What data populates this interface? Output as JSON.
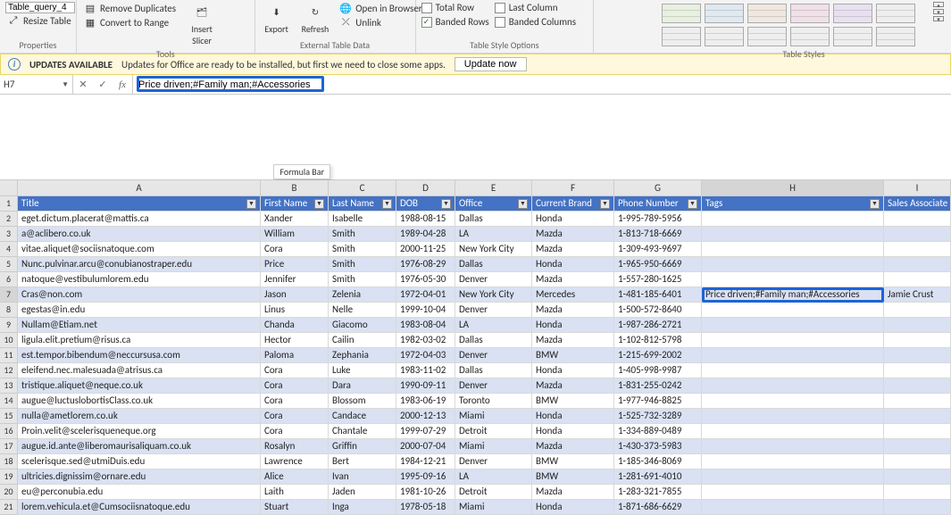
{
  "ribbon": {
    "properties": {
      "table_name": "Table_query_4",
      "resize": "Resize Table",
      "group": "Properties"
    },
    "tools": {
      "remove_dup": "Remove Duplicates",
      "convert": "Convert to Range",
      "slicer": "Insert Slicer",
      "group": "Tools"
    },
    "external": {
      "export": "Export",
      "refresh": "Refresh",
      "open_browser": "Open in Browser",
      "unlink": "Unlink",
      "group": "External Table Data"
    },
    "options": {
      "total_row": "Total Row",
      "banded_rows": "Banded Rows",
      "last_col": "Last Column",
      "banded_cols": "Banded Columns",
      "group": "Table Style Options"
    },
    "styles": {
      "group": "Table Styles"
    }
  },
  "update_bar": {
    "title": "UPDATES AVAILABLE",
    "msg": "Updates for Office are ready to be installed, but first we need to close some apps.",
    "btn": "Update now"
  },
  "formula_bar": {
    "cell_ref": "H7",
    "value": "Price driven;#Family man;#Accessories",
    "tooltip": "Formula Bar"
  },
  "columns": [
    "A",
    "B",
    "C",
    "D",
    "E",
    "F",
    "G",
    "H",
    "I"
  ],
  "headers": {
    "title": "Title",
    "first": "First Name",
    "last": "Last Name",
    "dob": "DOB",
    "office": "Office",
    "brand": "Current Brand",
    "phone": "Phone Number",
    "tags": "Tags",
    "assoc": "Sales Associate"
  },
  "rows": [
    {
      "n": 2,
      "title": "eget.dictum.placerat@mattis.ca",
      "first": "Xander",
      "last": "Isabelle",
      "dob": "1988-08-15",
      "office": "Dallas",
      "brand": "Honda",
      "phone": "1-995-789-5956",
      "tags": "",
      "assoc": ""
    },
    {
      "n": 3,
      "title": "a@aclibero.co.uk",
      "first": "William",
      "last": "Smith",
      "dob": "1989-04-28",
      "office": "LA",
      "brand": "Mazda",
      "phone": "1-813-718-6669",
      "tags": "",
      "assoc": ""
    },
    {
      "n": 4,
      "title": "vitae.aliquet@sociisnatoque.com",
      "first": "Cora",
      "last": "Smith",
      "dob": "2000-11-25",
      "office": "New York City",
      "brand": "Mazda",
      "phone": "1-309-493-9697",
      "tags": "",
      "assoc": ""
    },
    {
      "n": 5,
      "title": "Nunc.pulvinar.arcu@conubianostraper.edu",
      "first": "Price",
      "last": "Smith",
      "dob": "1976-08-29",
      "office": "Dallas",
      "brand": "Honda",
      "phone": "1-965-950-6669",
      "tags": "",
      "assoc": ""
    },
    {
      "n": 6,
      "title": "natoque@vestibulumlorem.edu",
      "first": "Jennifer",
      "last": "Smith",
      "dob": "1976-05-30",
      "office": "Denver",
      "brand": "Mazda",
      "phone": "1-557-280-1625",
      "tags": "",
      "assoc": ""
    },
    {
      "n": 7,
      "title": "Cras@non.com",
      "first": "Jason",
      "last": "Zelenia",
      "dob": "1972-04-01",
      "office": "New York City",
      "brand": "Mercedes",
      "phone": "1-481-185-6401",
      "tags": "Price driven;#Family man;#Accessories",
      "assoc": "Jamie Crust"
    },
    {
      "n": 8,
      "title": "egestas@in.edu",
      "first": "Linus",
      "last": "Nelle",
      "dob": "1999-10-04",
      "office": "Denver",
      "brand": "Mazda",
      "phone": "1-500-572-8640",
      "tags": "",
      "assoc": ""
    },
    {
      "n": 9,
      "title": "Nullam@Etiam.net",
      "first": "Chanda",
      "last": "Giacomo",
      "dob": "1983-08-04",
      "office": "LA",
      "brand": "Honda",
      "phone": "1-987-286-2721",
      "tags": "",
      "assoc": ""
    },
    {
      "n": 10,
      "title": "ligula.elit.pretium@risus.ca",
      "first": "Hector",
      "last": "Cailin",
      "dob": "1982-03-02",
      "office": "Dallas",
      "brand": "Mazda",
      "phone": "1-102-812-5798",
      "tags": "",
      "assoc": ""
    },
    {
      "n": 11,
      "title": "est.tempor.bibendum@neccursusa.com",
      "first": "Paloma",
      "last": "Zephania",
      "dob": "1972-04-03",
      "office": "Denver",
      "brand": "BMW",
      "phone": "1-215-699-2002",
      "tags": "",
      "assoc": ""
    },
    {
      "n": 12,
      "title": "eleifend.nec.malesuada@atrisus.ca",
      "first": "Cora",
      "last": "Luke",
      "dob": "1983-11-02",
      "office": "Dallas",
      "brand": "Honda",
      "phone": "1-405-998-9987",
      "tags": "",
      "assoc": ""
    },
    {
      "n": 13,
      "title": "tristique.aliquet@neque.co.uk",
      "first": "Cora",
      "last": "Dara",
      "dob": "1990-09-11",
      "office": "Denver",
      "brand": "Mazda",
      "phone": "1-831-255-0242",
      "tags": "",
      "assoc": ""
    },
    {
      "n": 14,
      "title": "augue@luctuslobortisClass.co.uk",
      "first": "Cora",
      "last": "Blossom",
      "dob": "1983-06-19",
      "office": "Toronto",
      "brand": "BMW",
      "phone": "1-977-946-8825",
      "tags": "",
      "assoc": ""
    },
    {
      "n": 15,
      "title": "nulla@ametlorem.co.uk",
      "first": "Cora",
      "last": "Candace",
      "dob": "2000-12-13",
      "office": "Miami",
      "brand": "Honda",
      "phone": "1-525-732-3289",
      "tags": "",
      "assoc": ""
    },
    {
      "n": 16,
      "title": "Proin.velit@scelerisqueneque.org",
      "first": "Cora",
      "last": "Chantale",
      "dob": "1999-07-29",
      "office": "Detroit",
      "brand": "Honda",
      "phone": "1-334-889-0489",
      "tags": "",
      "assoc": ""
    },
    {
      "n": 17,
      "title": "augue.id.ante@liberomaurisaliquam.co.uk",
      "first": "Rosalyn",
      "last": "Griffin",
      "dob": "2000-07-04",
      "office": "Miami",
      "brand": "Mazda",
      "phone": "1-430-373-5983",
      "tags": "",
      "assoc": ""
    },
    {
      "n": 18,
      "title": "scelerisque.sed@utmiDuis.edu",
      "first": "Lawrence",
      "last": "Bert",
      "dob": "1984-12-21",
      "office": "Denver",
      "brand": "BMW",
      "phone": "1-185-346-8069",
      "tags": "",
      "assoc": ""
    },
    {
      "n": 19,
      "title": "ultricies.dignissim@ornare.edu",
      "first": "Alice",
      "last": "Ivan",
      "dob": "1995-09-16",
      "office": "LA",
      "brand": "BMW",
      "phone": "1-281-691-4010",
      "tags": "",
      "assoc": ""
    },
    {
      "n": 20,
      "title": "eu@perconubia.edu",
      "first": "Laith",
      "last": "Jaden",
      "dob": "1981-10-26",
      "office": "Detroit",
      "brand": "Mazda",
      "phone": "1-283-321-7855",
      "tags": "",
      "assoc": ""
    },
    {
      "n": 21,
      "title": "lorem.vehicula.et@Cumsociisnatoque.edu",
      "first": "Stuart",
      "last": "Inga",
      "dob": "1978-05-18",
      "office": "Miami",
      "brand": "Honda",
      "phone": "1-871-686-6629",
      "tags": "",
      "assoc": ""
    }
  ]
}
